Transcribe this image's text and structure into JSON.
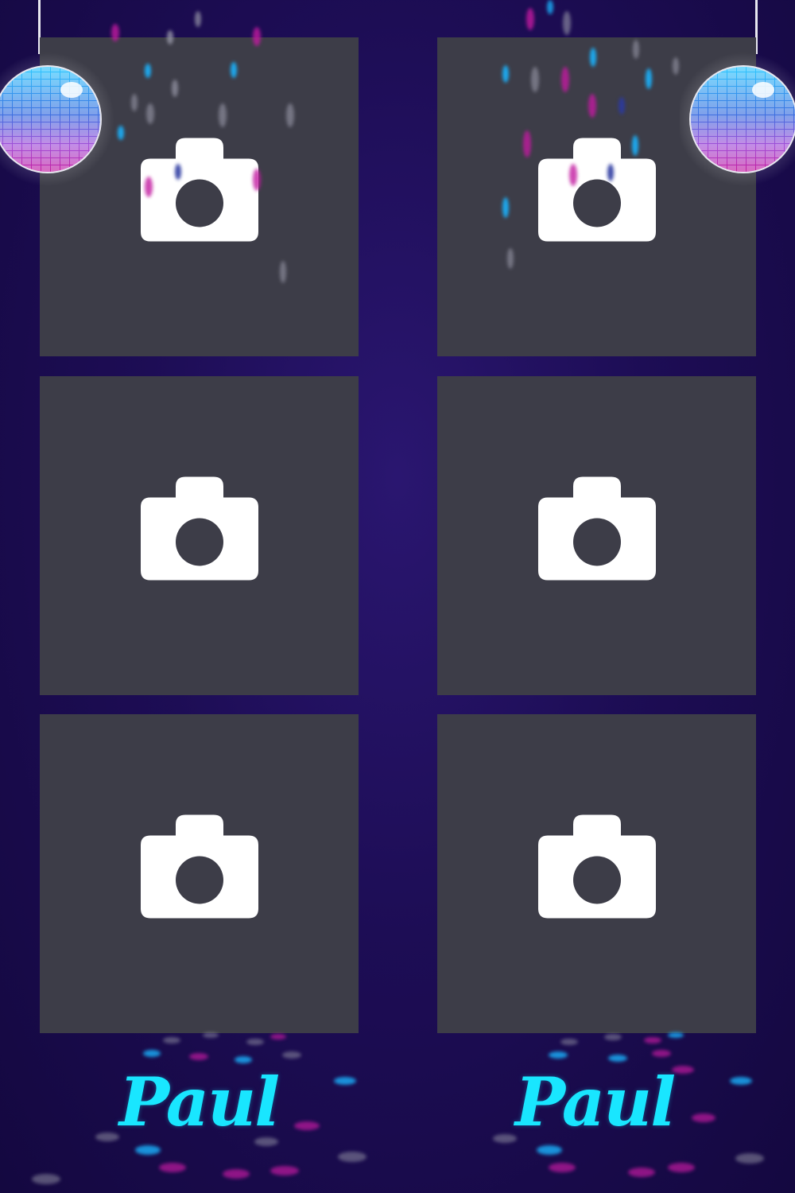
{
  "name_left": "Paul",
  "name_right": "Paul",
  "colors": {
    "background": "#1d0d55",
    "slot": "#3d3d48",
    "camera_icon": "#ffffff",
    "name_text": "#19e6ff",
    "light_pink": "#d21aa8",
    "light_cyan": "#1ab4ff"
  },
  "icons": [
    "camera-icon",
    "disco-ball-icon"
  ]
}
